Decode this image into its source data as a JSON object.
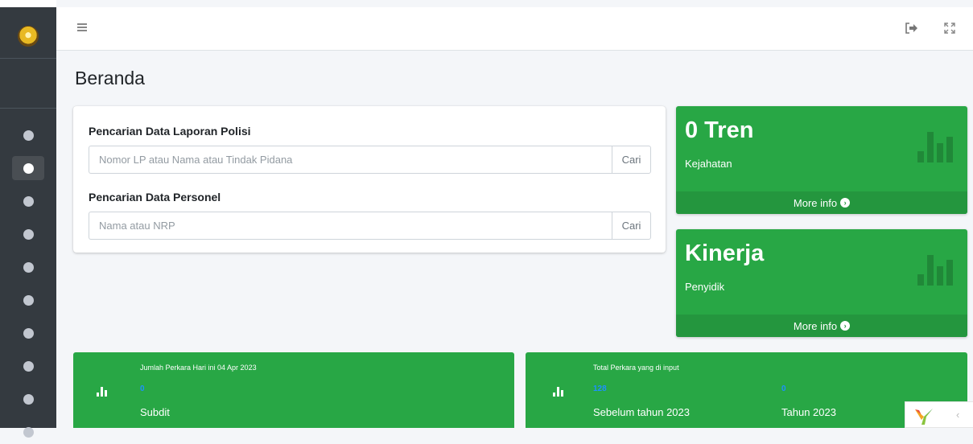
{
  "sidebar": {
    "items": [
      {
        "icon": "circle-icon",
        "active": false
      },
      {
        "icon": "circle-icon",
        "active": true
      },
      {
        "icon": "circle-icon",
        "active": false
      },
      {
        "icon": "circle-icon",
        "active": false
      },
      {
        "icon": "circle-icon",
        "active": false
      },
      {
        "icon": "circle-icon",
        "active": false
      },
      {
        "icon": "circle-icon",
        "active": false
      },
      {
        "icon": "circle-icon",
        "active": false
      },
      {
        "icon": "circle-icon",
        "active": false
      },
      {
        "icon": "circle-icon",
        "active": false
      }
    ]
  },
  "topbar": {
    "menu_icon": "hamburger-icon",
    "logout_icon": "sign-out-icon",
    "fullscreen_icon": "expand-icon"
  },
  "page": {
    "title": "Beranda"
  },
  "search": {
    "laporan": {
      "label": "Pencarian Data Laporan Polisi",
      "placeholder": "Nomor LP atau Nama atau Tindak Pidana",
      "button": "Cari"
    },
    "personel": {
      "label": "Pencarian Data Personel",
      "placeholder": "Nama atau NRP",
      "button": "Cari"
    }
  },
  "boxes": {
    "tren": {
      "title": "0 Tren",
      "subtitle": "Kejahatan",
      "footer": "More info"
    },
    "kinerja": {
      "title": "Kinerja",
      "subtitle": "Penyidik",
      "footer": "More info"
    }
  },
  "info": {
    "perkara_hari_ini": {
      "caption": "Jumlah Perkara Hari ini 04 Apr 2023",
      "value": "0",
      "label": "Subdit"
    },
    "total_perkara": {
      "caption": "Total Perkara yang di input",
      "value1": "128",
      "label1": "Sebelum tahun 2023",
      "value2": "0",
      "label2": "Tahun 2023"
    }
  },
  "colors": {
    "sidebar": "#343a40",
    "success": "#28a745",
    "success_dark": "#24963e",
    "link_blue": "#1e90ff"
  }
}
